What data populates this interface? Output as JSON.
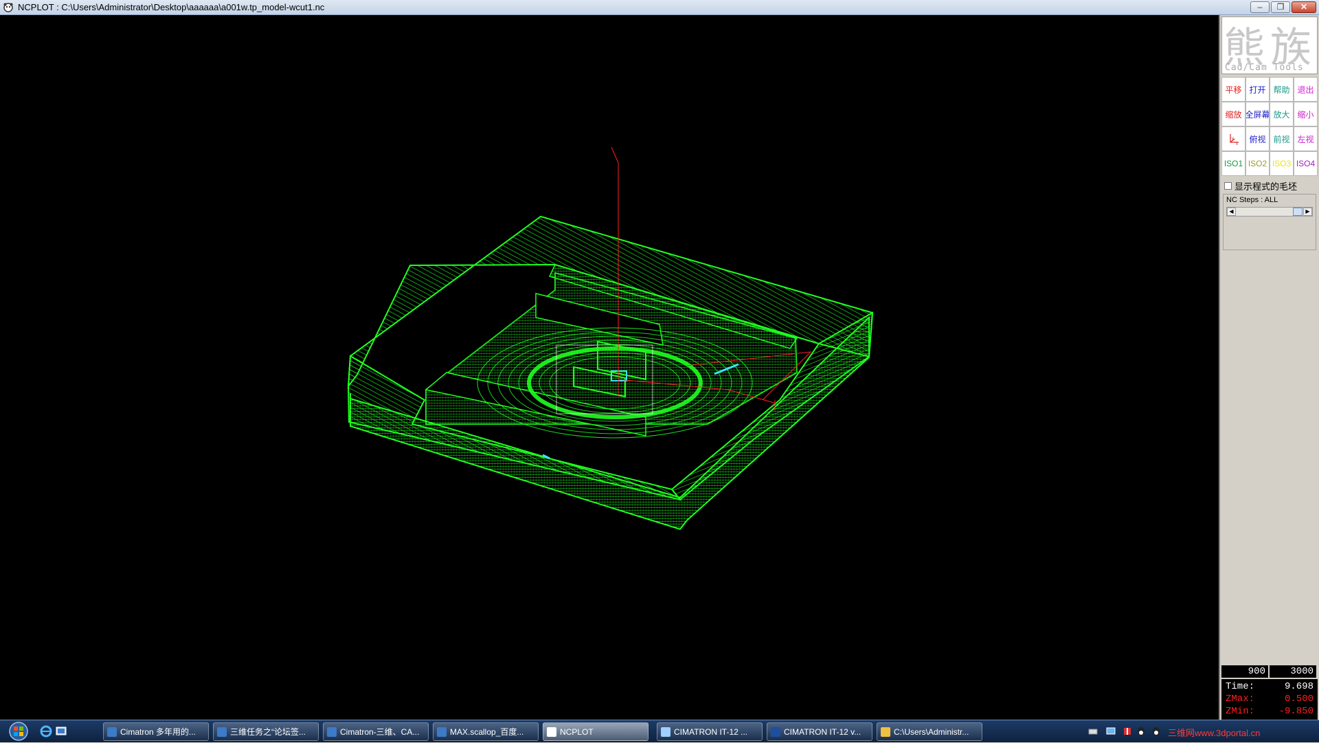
{
  "window": {
    "title": "NCPLOT : C:\\Users\\Administrator\\Desktop\\aaaaaa\\a001w.tp_model-wcut1.nc",
    "minimize_symbol": "‒",
    "maximize_symbol": "❐",
    "close_symbol": "✕"
  },
  "logo": {
    "main_text": "熊族",
    "sub_text": "Cad/Cam Tools"
  },
  "toolbar": [
    {
      "label": "平移",
      "color": "#e02020",
      "icon": "pan"
    },
    {
      "label": "打开",
      "color": "#2020d0",
      "icon": "open"
    },
    {
      "label": "帮助",
      "color": "#1a9a8a",
      "icon": "help"
    },
    {
      "label": "退出",
      "color": "#d020d0",
      "icon": "exit"
    },
    {
      "label": "缩放",
      "color": "#e02020",
      "icon": "zoom"
    },
    {
      "label": "全屏幕",
      "color": "#2020d0",
      "icon": "fullscreen"
    },
    {
      "label": "放大",
      "color": "#1a9a8a",
      "icon": "zoom-in"
    },
    {
      "label": "缩小",
      "color": "#d020d0",
      "icon": "zoom-out"
    },
    {
      "label": "",
      "color": "#e02020",
      "icon": "axes-icon"
    },
    {
      "label": "俯视",
      "color": "#2020d0",
      "icon": "top-view"
    },
    {
      "label": "前视",
      "color": "#1a9a8a",
      "icon": "front-view"
    },
    {
      "label": "左视",
      "color": "#d020d0",
      "icon": "left-view"
    },
    {
      "label": "ISO1",
      "color": "#1a9a3a",
      "icon": "iso1"
    },
    {
      "label": "ISO2",
      "color": "#9a9a30",
      "icon": "iso2"
    },
    {
      "label": "ISO3",
      "color": "#e8e800",
      "icon": "iso3"
    },
    {
      "label": "ISO4",
      "color": "#a020c0",
      "icon": "iso4"
    }
  ],
  "panel": {
    "show_stock_label": "显示程式的毛坯",
    "nc_steps_label": "NC Steps : ALL",
    "readout_left": "900",
    "readout_right": "3000"
  },
  "stats": [
    {
      "label": "Time:",
      "value": "9.698",
      "color": "#ffffff"
    },
    {
      "label": "ZMax:",
      "value": "0.500",
      "color": "#ff2020"
    },
    {
      "label": "ZMin:",
      "value": "-9.850",
      "color": "#ff2020"
    }
  ],
  "taskbar": {
    "items": [
      {
        "label": "Cimatron 多年用的...",
        "icon": "browser-page",
        "active": false
      },
      {
        "label": "三维任务之“论坛签...",
        "icon": "browser-page",
        "active": false
      },
      {
        "label": "Cimatron-三维、CA...",
        "icon": "browser-page",
        "active": false
      },
      {
        "label": "MAX.scallop_百度...",
        "icon": "browser-page",
        "active": false
      },
      {
        "label": "NCPLOT",
        "icon": "ncplot",
        "active": true
      },
      {
        "label": "CIMATRON IT-12 ...",
        "icon": "cimatron-window",
        "active": false
      },
      {
        "label": "CIMATRON IT-12 v...",
        "icon": "cimatron-app",
        "active": false
      },
      {
        "label": "C:\\Users\\Administr...",
        "icon": "folder",
        "active": false
      }
    ],
    "tray_watermark": "三维网www.3dportal.cn"
  }
}
